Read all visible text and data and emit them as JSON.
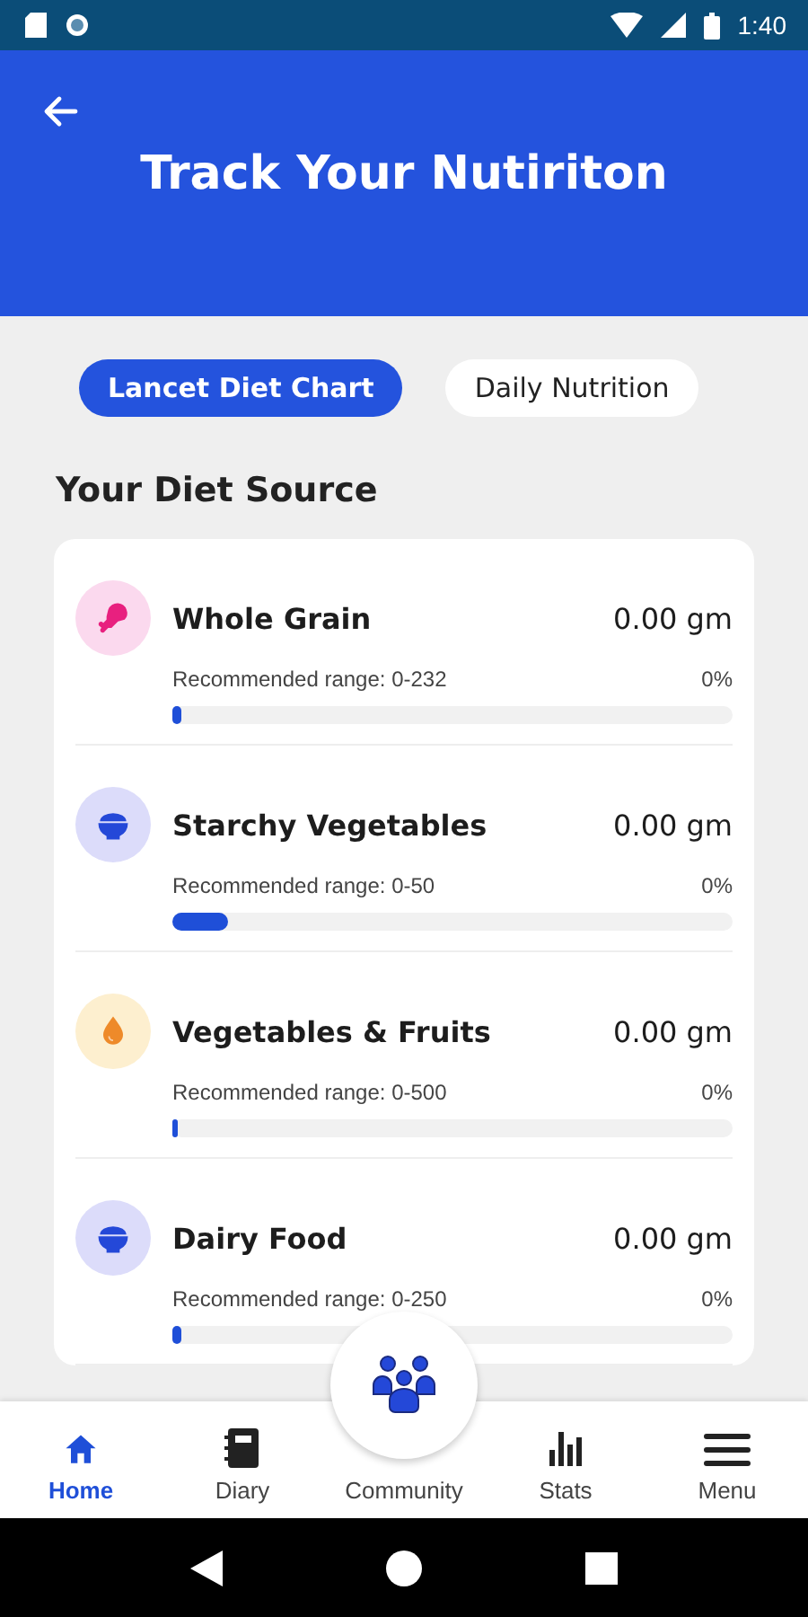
{
  "status_bar": {
    "time": "1:40"
  },
  "header": {
    "title": "Track Your Nutiriton"
  },
  "tabs": [
    {
      "label": "Lancet Diet Chart",
      "selected": true
    },
    {
      "label": "Daily Nutrition",
      "selected": false
    }
  ],
  "section_title": "Your Diet Source",
  "sources": [
    {
      "name": "Whole Grain",
      "amount": "0.00 gm",
      "range": "Recommended range: 0-232",
      "percent": "0%",
      "level": 0.015,
      "kind": "drumstick",
      "color": "#e8207f"
    },
    {
      "name": "Starchy Vegetables",
      "amount": "0.00 gm",
      "range": "Recommended range: 0-50",
      "percent": "0%",
      "level": 0.1,
      "kind": "bowl",
      "color": "#2448d8"
    },
    {
      "name": "Vegetables & Fruits",
      "amount": "0.00 gm",
      "range": "Recommended range: 0-500",
      "percent": "0%",
      "level": 0.006,
      "kind": "drop",
      "color": "#ee8a2a"
    },
    {
      "name": "Dairy Food",
      "amount": "0.00 gm",
      "range": "Recommended range: 0-250",
      "percent": "0%",
      "level": 0.015,
      "kind": "bowl",
      "color": "#2448d8"
    }
  ],
  "bottom_nav": [
    {
      "label": "Home",
      "kind": "home",
      "selected": true
    },
    {
      "label": "Diary",
      "kind": "diary",
      "selected": false
    },
    {
      "label": "Community",
      "kind": "community",
      "selected": false
    },
    {
      "label": "Stats",
      "kind": "stats",
      "selected": false
    },
    {
      "label": "Menu",
      "kind": "menu",
      "selected": false
    }
  ]
}
